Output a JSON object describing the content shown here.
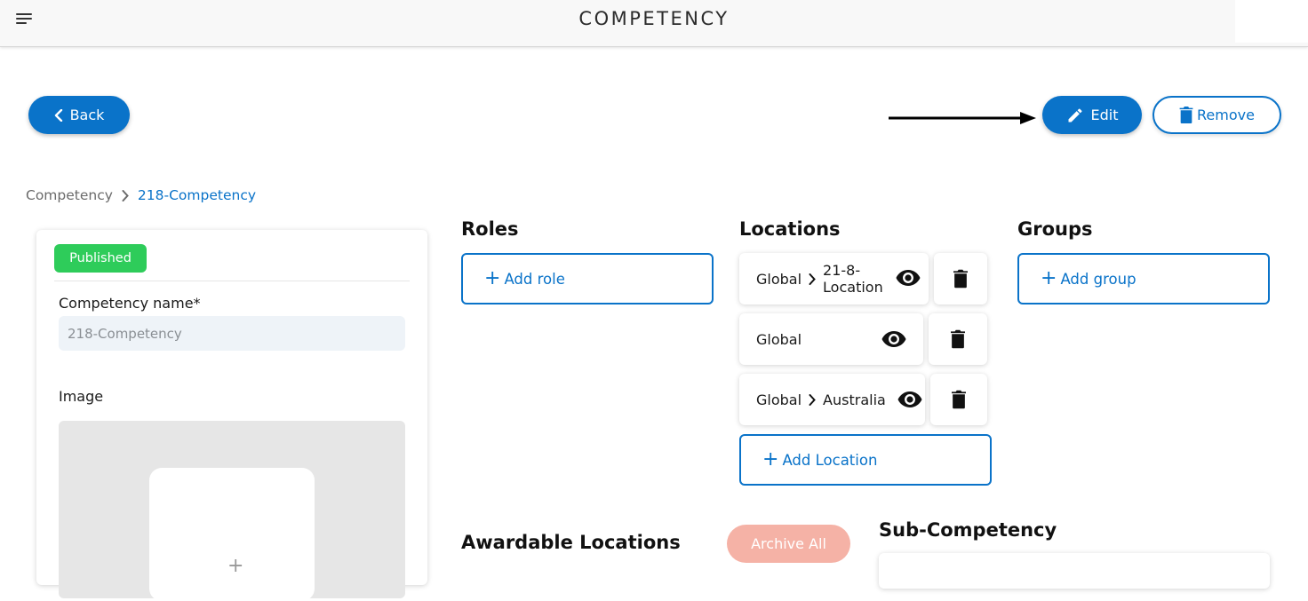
{
  "header": {
    "title": "COMPETENCY",
    "menu_icon": "hamburger-icon"
  },
  "actions": {
    "back_label": "Back",
    "edit_label": "Edit",
    "remove_label": "Remove"
  },
  "breadcrumb": {
    "root": "Competency",
    "current": "218-Competency"
  },
  "details": {
    "status": "Published",
    "name_label": "Competency name*",
    "name_value": "218-Competency",
    "image_label": "Image"
  },
  "roles": {
    "title": "Roles",
    "add_label": "Add role"
  },
  "locations": {
    "title": "Locations",
    "items": [
      {
        "parent": "Global",
        "child_line1": "21-8-",
        "child_line2": "Location"
      },
      {
        "parent": "Global"
      },
      {
        "parent": "Global",
        "child": "Australia"
      }
    ],
    "add_label": "Add Location"
  },
  "groups": {
    "title": "Groups",
    "add_label": "Add group"
  },
  "awardable": {
    "title": "Awardable Locations",
    "archive_label": "Archive All"
  },
  "sub_competency": {
    "title": "Sub-Competency"
  },
  "colors": {
    "primary": "#0a73c9",
    "published": "#2ecc5a",
    "archive": "#f5b2a6"
  }
}
